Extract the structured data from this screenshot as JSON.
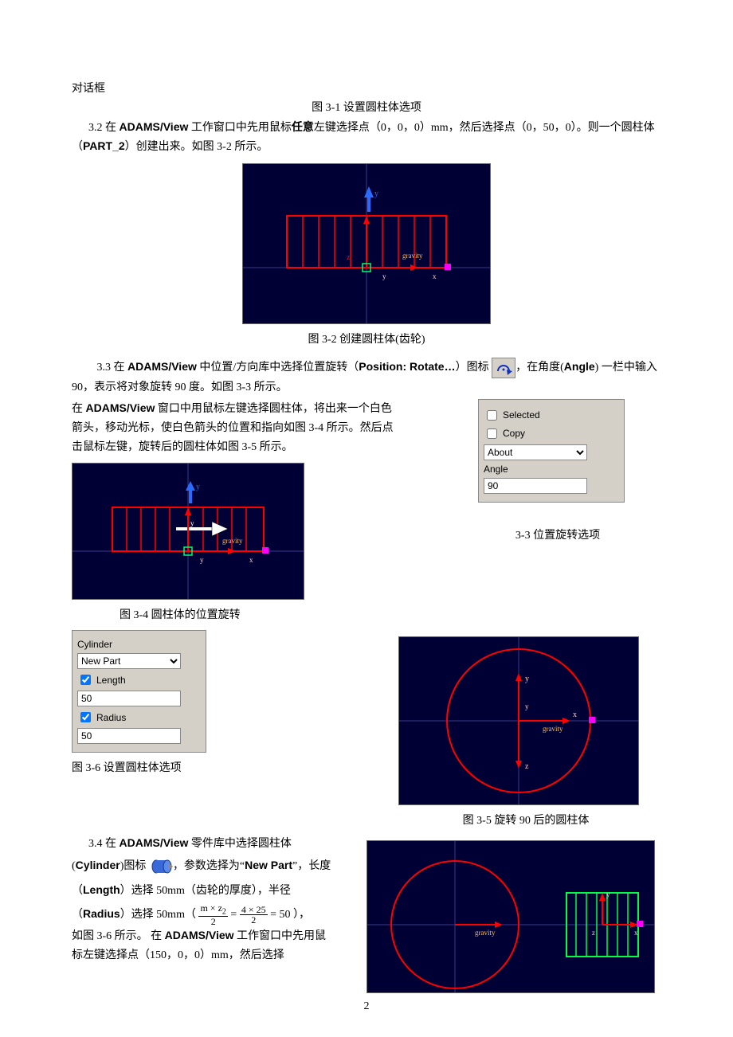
{
  "top_text": "对话框",
  "cap_3_1": "图 3-1 设置圆柱体选项",
  "p_3_2_pre": "3.2  在 ",
  "adams_view": "ADAMS/View",
  "p_3_2_a": " 工作窗口中先用鼠标",
  "arbitrary": "任意",
  "p_3_2_b": "左键选择点（0，0，0）mm，然后选择点（0，50，0）。则一个圆柱体（",
  "part2": "PART_2",
  "p_3_2_c": "）创建出来。如图 3-2 所示。",
  "cap_3_2": "图 3-2  创建圆柱体(齿轮)",
  "p_3_3_a": "3.3  在 ",
  "p_3_3_b": " 中位置/方向库中选择位置旋转（",
  "pos_rotate": "Position: Rotate…",
  "p_3_3_c": "）图标",
  "p_3_3_d": "，在角度(",
  "angle_en": "Angle",
  "p_3_3_e": ") 一栏中输入 90，表示将对象旋转 90 度。如图 3-3 所示。",
  "p_3_3_f1": "在 ",
  "p_3_3_f2": " 窗口中用鼠标左键选择圆柱体，将出来一个白色箭头，移动光标，使白色箭头的位置和指向如图 3-4 所示。然后点击鼠标左键，旋转后的圆柱体如图 3-5 所示。",
  "cap_3_4": "图  3-4  圆柱体的位置旋转",
  "cap_3_3": "3-3  位置旋转选项",
  "cap_3_5": "图 3-5  旋转 90 后的圆柱体",
  "cap_3_6": "图 3-6 设置圆柱体选项",
  "p_3_4_a": "3.4  在 ",
  "p_3_4_b": " 零件库中选择圆柱体",
  "p_3_4_c1": "(",
  "cylinder_en": "Cylinder",
  "p_3_4_c2": ")图标",
  "p_3_4_c3": "，参数选择为“",
  "new_part": "New Part",
  "p_3_4_c4": "”，长度（",
  "length_en": "Length",
  "p_3_4_c5": "）选择 50mm（齿轮的厚度），半径（",
  "radius_en": "Radius",
  "p_3_4_c6": "）选择 50mm（",
  "formula_tail": "= 50 ），",
  "p_3_4_d": "如图 3-6 所示。  在 ",
  "p_3_4_e": " 工作窗口中先用鼠标左键选择点（150，0，0）mm，然后选择",
  "angle_panel": {
    "selected": "Selected",
    "copy": "Copy",
    "about": "About",
    "angle_label": "Angle",
    "angle_value": "90"
  },
  "cyl_panel": {
    "title": "Cylinder",
    "new_part": "New Part",
    "length_label": "Length",
    "length_value": "50",
    "radius_label": "Radius",
    "radius_value": "50"
  },
  "formula": {
    "num1_a": "m × z",
    "num1_sub": "2",
    "den1": "2",
    "num2": "4 × 25",
    "den2": "2"
  },
  "page_number": "2",
  "gravity_label": "gravity"
}
